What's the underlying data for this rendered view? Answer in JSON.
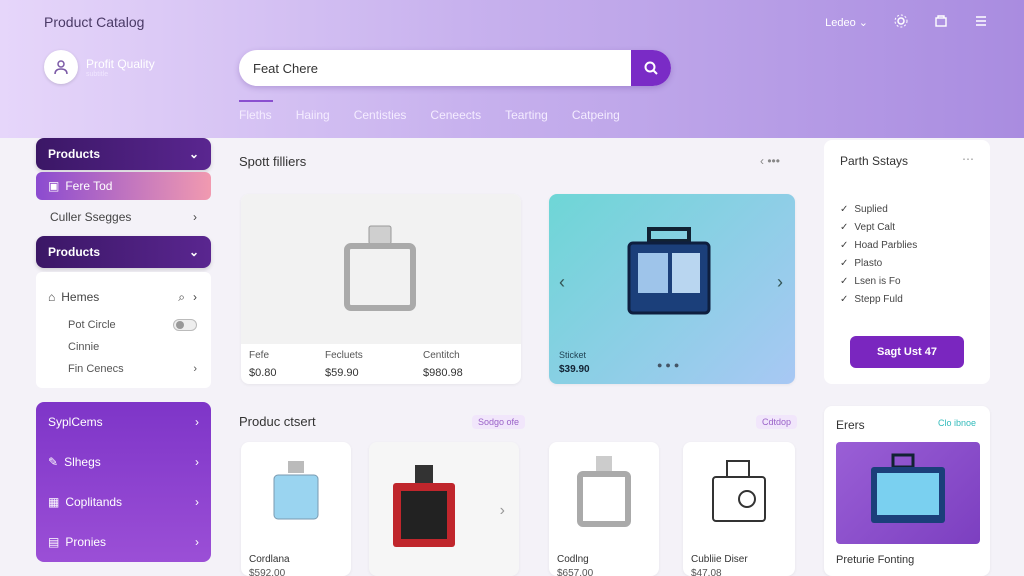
{
  "app": {
    "title": "Product Catalog"
  },
  "brand": {
    "name": "Profit Quality",
    "sub": "subtitle"
  },
  "search": {
    "value": "Feat Chere"
  },
  "top_right": {
    "language": "Ledeo ⌄"
  },
  "tabs": [
    "Fleths",
    "Haiing",
    "Centisties",
    "Ceneects",
    "Tearting",
    "Catpeing"
  ],
  "sidebar": {
    "head1": "Products",
    "selected": "Fere Tod",
    "item1": "Culler Ssegges",
    "head2": "Products",
    "sub_head": "Hemes",
    "sub_items": [
      {
        "label": "Pot Circle",
        "control": "toggle"
      },
      {
        "label": "Cinnie",
        "control": ""
      },
      {
        "label": "Fin Cenecs",
        "control": "chevron"
      }
    ],
    "purple_items": [
      "SyplCems",
      "Slhegs",
      "Coplitands",
      "Pronies"
    ]
  },
  "spot_section": {
    "title": "Spott filliers",
    "nav": "‹ •••"
  },
  "feature_card": {
    "columns": [
      {
        "label": "Fefe",
        "price": "$0.80"
      },
      {
        "label": "Fecluets",
        "price": "$59.90"
      },
      {
        "label": "Centitch",
        "price": "$980.98"
      }
    ]
  },
  "hero_card": {
    "label": "Sticket",
    "price": "$39.90"
  },
  "right_panel": {
    "title": "Parth Sstays",
    "items": [
      "Suplied",
      "Vept Calt",
      "Hoad Parblies",
      "Plasto",
      "Lsen is Fo",
      "Stepp Fuld"
    ],
    "button": "Sagt Ust 47"
  },
  "product_section": {
    "title": "Produc ctsert",
    "badge1": "Sodgo ofe",
    "badge2": "Cdtdop"
  },
  "products": [
    {
      "name": "Cordlana",
      "price": "$592.00"
    },
    {
      "name": "",
      "price": ""
    },
    {
      "name": "Codlng",
      "price": "$657.00"
    },
    {
      "name": "Cubliie Diser",
      "price": "$47.08"
    }
  ],
  "promo": {
    "title": "Erers",
    "link": "Clo ibnoe",
    "caption": "Preturie Fonting"
  },
  "colors": {
    "accent": "#7a2bc6",
    "dark": "#3b1766",
    "header_start": "#e6d6fa",
    "header_end": "#a98ce0"
  }
}
